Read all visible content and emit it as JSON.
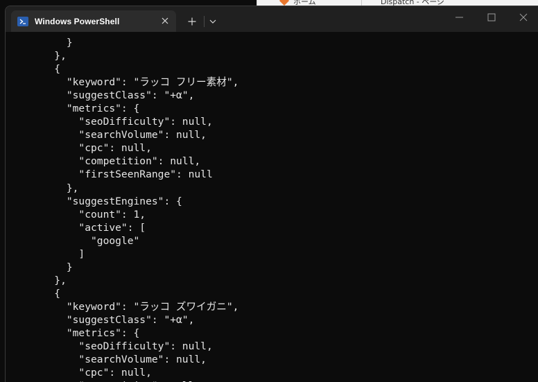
{
  "window": {
    "tab_title": "Windows PowerShell",
    "tab_icon": "powershell-icon",
    "accent": "#2a5fb0"
  },
  "background_window": {
    "tab1": "ホーム",
    "tab2": "Dispatch - ページ"
  },
  "terminal": {
    "lines": [
      "          }",
      "        },",
      "        {",
      "          \"keyword\": \"ラッコ フリー素材\",",
      "          \"suggestClass\": \"+α\",",
      "          \"metrics\": {",
      "            \"seoDifficulty\": null,",
      "            \"searchVolume\": null,",
      "            \"cpc\": null,",
      "            \"competition\": null,",
      "            \"firstSeenRange\": null",
      "          },",
      "          \"suggestEngines\": {",
      "            \"count\": 1,",
      "            \"active\": [",
      "              \"google\"",
      "            ]",
      "          }",
      "        },",
      "        {",
      "          \"keyword\": \"ラッコ ズワイガニ\",",
      "          \"suggestClass\": \"+α\",",
      "          \"metrics\": {",
      "            \"seoDifficulty\": null,",
      "            \"searchVolume\": null,",
      "            \"cpc\": null,",
      "            \"competition\": null,"
    ]
  }
}
